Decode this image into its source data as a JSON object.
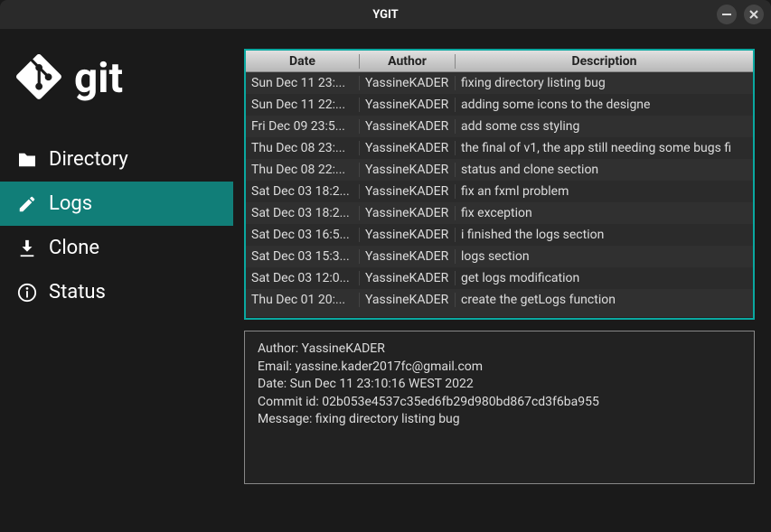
{
  "window": {
    "title": "YGIT"
  },
  "logo": {
    "text": "git"
  },
  "sidebar": {
    "items": [
      {
        "key": "directory",
        "label": "Directory"
      },
      {
        "key": "logs",
        "label": "Logs"
      },
      {
        "key": "clone",
        "label": "Clone"
      },
      {
        "key": "status",
        "label": "Status"
      }
    ],
    "active": "logs"
  },
  "table": {
    "headers": {
      "date": "Date",
      "author": "Author",
      "description": "Description"
    },
    "rows": [
      {
        "date": "Sun Dec 11 23:...",
        "author": "YassineKADER",
        "desc": "fixing directory listing bug"
      },
      {
        "date": "Sun Dec 11 22:...",
        "author": "YassineKADER",
        "desc": "adding some icons to the designe"
      },
      {
        "date": "Fri Dec 09 23:5...",
        "author": "YassineKADER",
        "desc": "add some css styling"
      },
      {
        "date": "Thu Dec 08 23:...",
        "author": "YassineKADER",
        "desc": "the final of v1, the app still needing some bugs fi"
      },
      {
        "date": "Thu Dec 08 22:...",
        "author": "YassineKADER",
        "desc": "status and clone section"
      },
      {
        "date": "Sat Dec 03 18:2...",
        "author": "YassineKADER",
        "desc": "fix an fxml problem"
      },
      {
        "date": "Sat Dec 03 18:2...",
        "author": "YassineKADER",
        "desc": "fix exception"
      },
      {
        "date": "Sat Dec 03 16:5...",
        "author": "YassineKADER",
        "desc": "i finished the logs section"
      },
      {
        "date": "Sat Dec 03 15:3...",
        "author": "YassineKADER",
        "desc": "logs section"
      },
      {
        "date": "Sat Dec 03 12:0...",
        "author": "YassineKADER",
        "desc": "get logs modification"
      },
      {
        "date": "Thu Dec 01 20:...",
        "author": "YassineKADER",
        "desc": "create the getLogs function"
      }
    ]
  },
  "details": {
    "author_label": "Author: ",
    "author": "YassineKADER",
    "email_label": "Email: ",
    "email": "yassine.kader2017fc@gmail.com",
    "date_label": "Date: ",
    "date": "Sun Dec 11 23:10:16 WEST 2022",
    "commit_label": "Commit id: ",
    "commit": "02b053e4537c35ed6fb29d980bd867cd3f6ba955",
    "message_label": "Message: ",
    "message": "fixing directory listing bug"
  }
}
